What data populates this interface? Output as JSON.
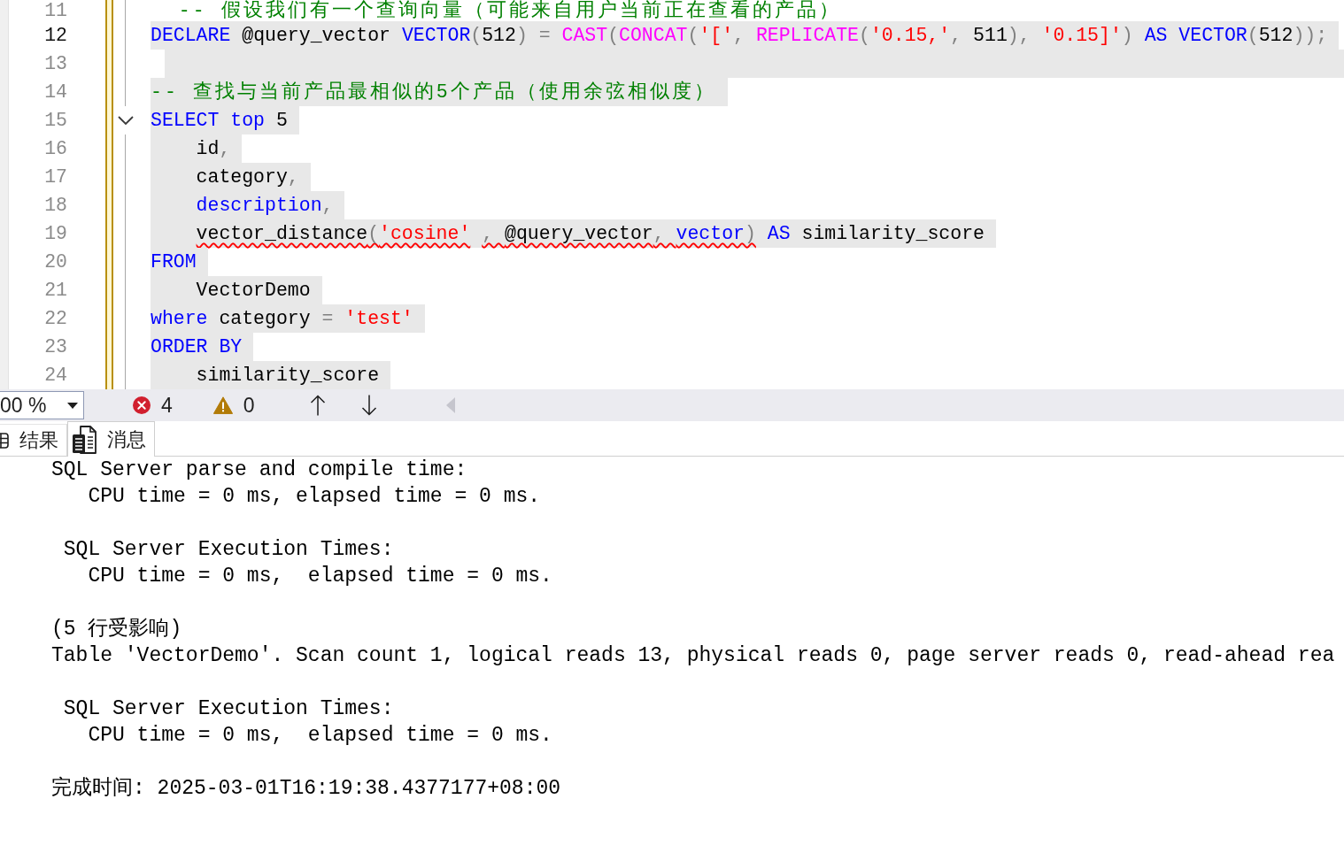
{
  "editor": {
    "lines": [
      {
        "number": "11",
        "current": false,
        "changed": true,
        "selected": false,
        "tokens": [
          {
            "kind": "comment",
            "text": "  -- 假设我们有一个查询向量（可能来自用户当前正在查看的产品）"
          }
        ]
      },
      {
        "number": "12",
        "current": true,
        "changed": true,
        "selected": true,
        "tokens": [
          {
            "kind": "keyword",
            "text": "DECLARE"
          },
          {
            "kind": "plain",
            "text": " @query_vector "
          },
          {
            "kind": "keyword",
            "text": "VECTOR"
          },
          {
            "kind": "operator",
            "text": "("
          },
          {
            "kind": "plain",
            "text": "512"
          },
          {
            "kind": "operator",
            "text": ") = "
          },
          {
            "kind": "function",
            "text": "CAST"
          },
          {
            "kind": "operator",
            "text": "("
          },
          {
            "kind": "function",
            "text": "CONCAT"
          },
          {
            "kind": "operator",
            "text": "("
          },
          {
            "kind": "string",
            "text": "'['"
          },
          {
            "kind": "operator",
            "text": ", "
          },
          {
            "kind": "function",
            "text": "REPLICATE"
          },
          {
            "kind": "operator",
            "text": "("
          },
          {
            "kind": "string",
            "text": "'0.15,'"
          },
          {
            "kind": "operator",
            "text": ", "
          },
          {
            "kind": "plain",
            "text": "511"
          },
          {
            "kind": "operator",
            "text": "), "
          },
          {
            "kind": "string",
            "text": "'0.15]'"
          },
          {
            "kind": "operator",
            "text": ") "
          },
          {
            "kind": "keyword",
            "text": "AS VECTOR"
          },
          {
            "kind": "operator",
            "text": "("
          },
          {
            "kind": "plain",
            "text": "512"
          },
          {
            "kind": "operator",
            "text": "));"
          }
        ]
      },
      {
        "number": "13",
        "current": false,
        "changed": true,
        "selected": true
      },
      {
        "number": "14",
        "current": false,
        "changed": true,
        "selected": true,
        "tokens": [
          {
            "kind": "comment",
            "text": "-- 查找与当前产品最相似的5个产品（使用余弦相似度）"
          }
        ]
      },
      {
        "number": "15",
        "current": false,
        "changed": true,
        "selected": true,
        "expanded": true,
        "tokens": [
          {
            "kind": "keyword",
            "text": "SELECT top"
          },
          {
            "kind": "plain",
            "text": " 5"
          }
        ]
      },
      {
        "number": "16",
        "current": false,
        "changed": true,
        "selected": true,
        "tokens": [
          {
            "kind": "plain",
            "text": "    id"
          },
          {
            "kind": "operator",
            "text": ","
          }
        ]
      },
      {
        "number": "17",
        "current": false,
        "changed": true,
        "selected": true,
        "tokens": [
          {
            "kind": "plain",
            "text": "    category"
          },
          {
            "kind": "operator",
            "text": ","
          }
        ]
      },
      {
        "number": "18",
        "current": false,
        "changed": true,
        "selected": true,
        "tokens": [
          {
            "kind": "keyword",
            "text": "    description"
          },
          {
            "kind": "operator",
            "text": ","
          }
        ]
      },
      {
        "number": "19",
        "current": false,
        "changed": true,
        "selected": true,
        "tokens": [
          {
            "kind": "plain",
            "text": "    vector_distance",
            "error": true
          },
          {
            "kind": "operator",
            "text": "(",
            "error": true
          },
          {
            "kind": "string",
            "text": "'cosine'",
            "error": true
          },
          {
            "kind": "operator",
            "text": " , ",
            "error": true
          },
          {
            "kind": "plain",
            "text": "@query_vector",
            "error": true
          },
          {
            "kind": "operator",
            "text": ", ",
            "error": true
          },
          {
            "kind": "keyword",
            "text": "vector",
            "error": true
          },
          {
            "kind": "operator",
            "text": ")",
            "error": true
          },
          {
            "kind": "keyword",
            "text": " AS",
            "error": false
          },
          {
            "kind": "plain",
            "text": " similarity_score",
            "error": false
          }
        ]
      },
      {
        "number": "20",
        "current": false,
        "changed": true,
        "selected": true,
        "tokens": [
          {
            "kind": "keyword",
            "text": "FROM"
          }
        ]
      },
      {
        "number": "21",
        "current": false,
        "changed": true,
        "selected": true,
        "tokens": [
          {
            "kind": "plain",
            "text": "    VectorDemo"
          }
        ]
      },
      {
        "number": "22",
        "current": false,
        "changed": true,
        "selected": true,
        "tokens": [
          {
            "kind": "keyword",
            "text": "where"
          },
          {
            "kind": "plain",
            "text": " category "
          },
          {
            "kind": "operator",
            "text": "="
          },
          {
            "kind": "string",
            "text": " 'test'"
          }
        ]
      },
      {
        "number": "23",
        "current": false,
        "changed": true,
        "selected": true,
        "tokens": [
          {
            "kind": "keyword",
            "text": "ORDER BY"
          }
        ]
      },
      {
        "number": "24",
        "current": false,
        "changed": true,
        "selected": true,
        "tokens": [
          {
            "kind": "plain",
            "text": "    similarity_score"
          }
        ]
      }
    ]
  },
  "status_strip": {
    "zoom": "00 %",
    "errors": "4",
    "warnings": "0"
  },
  "result_tabs": [
    {
      "label": "结果",
      "selected": false
    },
    {
      "label": "消息",
      "selected": true
    }
  ],
  "messages": [
    {
      "lines": [
        "SQL Server parse and compile time:",
        "   CPU time = 0 ms, elapsed time = 0 ms."
      ]
    },
    {
      "lines": [
        " SQL Server Execution Times:",
        "   CPU time = 0 ms,  elapsed time = 0 ms."
      ]
    },
    {
      "lines": [
        "(5 行受影响)",
        "Table 'VectorDemo'. Scan count 1, logical reads 13, physical reads 0, page server reads 0, read-ahead rea"
      ]
    },
    {
      "lines": [
        " SQL Server Execution Times:",
        "   CPU time = 0 ms,  elapsed time = 0 ms."
      ]
    },
    {
      "lines": [
        "完成时间: 2025-03-01T16:19:38.4377177+08:00"
      ]
    }
  ]
}
